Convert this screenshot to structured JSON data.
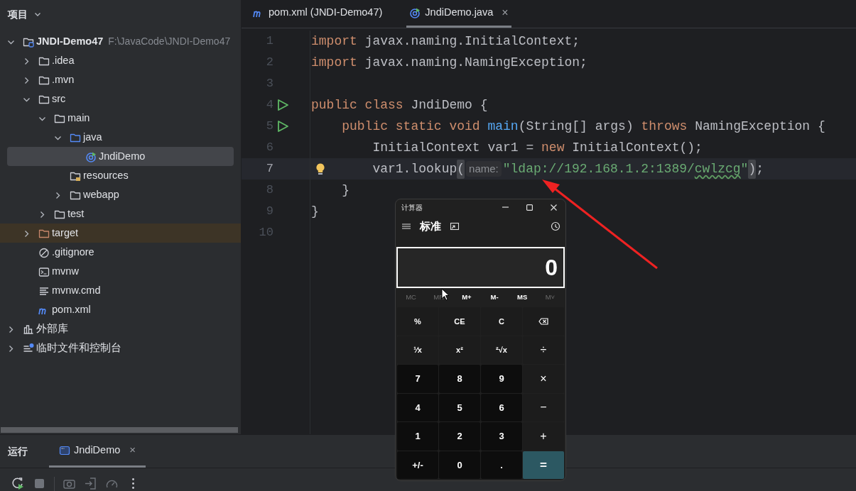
{
  "project_panel": {
    "title": "项目",
    "tree": [
      {
        "label": "JNDI-Demo47",
        "hint": "F:\\JavaCode\\JNDI-Demo47",
        "kind": "module",
        "expanded": true,
        "selected": false,
        "children": [
          {
            "label": ".idea",
            "kind": "folder",
            "expanded": false,
            "selected": false
          },
          {
            "label": ".mvn",
            "kind": "folder",
            "expanded": false,
            "selected": false
          },
          {
            "label": "src",
            "kind": "folder",
            "expanded": true,
            "selected": false,
            "children": [
              {
                "label": "main",
                "kind": "folder",
                "expanded": true,
                "selected": false,
                "children": [
                  {
                    "label": "java",
                    "kind": "source-folder",
                    "expanded": true,
                    "selected": false,
                    "children": [
                      {
                        "label": "JndiDemo",
                        "kind": "java-class",
                        "selected": true
                      }
                    ]
                  },
                  {
                    "label": "resources",
                    "kind": "resources-folder",
                    "selected": false
                  },
                  {
                    "label": "webapp",
                    "kind": "folder",
                    "expanded": false,
                    "selected": false
                  }
                ]
              },
              {
                "label": "test",
                "kind": "folder",
                "expanded": false,
                "selected": false
              }
            ]
          },
          {
            "label": "target",
            "kind": "excluded-folder",
            "expanded": false,
            "selected": false
          },
          {
            "label": ".gitignore",
            "kind": "ignore-file",
            "selected": false
          },
          {
            "label": "mvnw",
            "kind": "shell-file",
            "selected": false
          },
          {
            "label": "mvnw.cmd",
            "kind": "text-file",
            "selected": false
          },
          {
            "label": "pom.xml",
            "kind": "pom-file",
            "selected": false
          }
        ]
      },
      {
        "label": "外部库",
        "kind": "library",
        "expanded": false,
        "selected": false
      },
      {
        "label": "临时文件和控制台",
        "kind": "scratches",
        "expanded": false,
        "selected": false
      }
    ]
  },
  "editor": {
    "tabs": [
      {
        "label": "pom.xml (JNDI-Demo47)",
        "kind": "pom-file",
        "selected": false
      },
      {
        "label": "JndiDemo.java",
        "kind": "java-class",
        "selected": true,
        "close": "×"
      }
    ],
    "lines": [
      {
        "number": "1",
        "run": false,
        "bulb": false,
        "current": false,
        "tokens": [
          {
            "text": "import ",
            "kind": "kw"
          },
          {
            "text": "javax.naming.InitialContext;",
            "kind": "plain"
          }
        ]
      },
      {
        "number": "2",
        "run": false,
        "bulb": false,
        "current": false,
        "tokens": [
          {
            "text": "import ",
            "kind": "kw"
          },
          {
            "text": "javax.naming.NamingException;",
            "kind": "plain"
          }
        ]
      },
      {
        "number": "3",
        "run": false,
        "bulb": false,
        "current": false
      },
      {
        "number": "4",
        "run": true,
        "bulb": false,
        "current": false,
        "tokens": [
          {
            "text": "public class ",
            "kind": "kw"
          },
          {
            "text": "JndiDemo {",
            "kind": "plain"
          }
        ]
      },
      {
        "number": "5",
        "run": true,
        "bulb": false,
        "current": false,
        "tokens": [
          {
            "text": "    public static void ",
            "kind": "kw"
          },
          {
            "text": "main",
            "kind": "fn"
          },
          {
            "text": "(String[] args) ",
            "kind": "plain"
          },
          {
            "text": "throws ",
            "kind": "kw"
          },
          {
            "text": "NamingException {",
            "kind": "plain"
          }
        ]
      },
      {
        "number": "6",
        "run": false,
        "bulb": false,
        "current": false,
        "tokens": [
          {
            "text": "        InitialContext var1 = ",
            "kind": "plain"
          },
          {
            "text": "new ",
            "kind": "kw"
          },
          {
            "text": "InitialContext();",
            "kind": "plain"
          }
        ]
      },
      {
        "number": "7",
        "run": false,
        "bulb": true,
        "current": true,
        "tokens": [
          {
            "text": "        var1.lookup",
            "kind": "plain"
          },
          {
            "text": "(",
            "kind": "brace"
          },
          {
            "text": "name:",
            "kind": "hint"
          },
          {
            "text": "\"ldap://192.168.1.2:1389/",
            "kind": "str"
          },
          {
            "text": "cwlzcg",
            "kind": "typo"
          },
          {
            "text": "\"",
            "kind": "str"
          },
          {
            "text": ")",
            "kind": "brace"
          },
          {
            "text": ";",
            "kind": "plain"
          }
        ]
      },
      {
        "number": "8",
        "run": false,
        "bulb": false,
        "current": false,
        "tokens": [
          {
            "text": "    }",
            "kind": "plain"
          }
        ]
      },
      {
        "number": "9",
        "run": false,
        "bulb": false,
        "current": false,
        "tokens": [
          {
            "text": "}",
            "kind": "plain"
          }
        ]
      },
      {
        "number": "10",
        "run": false,
        "bulb": false,
        "current": false
      }
    ]
  },
  "calculator": {
    "title": "计算器",
    "mode": "标准",
    "display": "0",
    "memory": [
      {
        "label": "MC",
        "disabled": true
      },
      {
        "label": "MR",
        "disabled": true
      },
      {
        "label": "M+",
        "disabled": false
      },
      {
        "label": "M-",
        "disabled": false
      },
      {
        "label": "MS",
        "disabled": false
      },
      {
        "label": "M˅",
        "disabled": true
      }
    ],
    "keys": [
      {
        "label": "%",
        "kind": "function"
      },
      {
        "label": "CE",
        "kind": "function"
      },
      {
        "label": "C",
        "kind": "function"
      },
      {
        "kind": "backspace"
      },
      {
        "label": "¹⁄x",
        "kind": "function"
      },
      {
        "label": "x²",
        "kind": "function"
      },
      {
        "label": "²√x",
        "kind": "function"
      },
      {
        "label": "÷",
        "kind": "operator"
      },
      {
        "label": "7",
        "kind": "digit"
      },
      {
        "label": "8",
        "kind": "digit"
      },
      {
        "label": "9",
        "kind": "digit"
      },
      {
        "label": "×",
        "kind": "operator"
      },
      {
        "label": "4",
        "kind": "digit"
      },
      {
        "label": "5",
        "kind": "digit"
      },
      {
        "label": "6",
        "kind": "digit"
      },
      {
        "label": "−",
        "kind": "operator"
      },
      {
        "label": "1",
        "kind": "digit"
      },
      {
        "label": "2",
        "kind": "digit"
      },
      {
        "label": "3",
        "kind": "digit"
      },
      {
        "label": "+",
        "kind": "operator"
      },
      {
        "label": "+/-",
        "kind": "digit"
      },
      {
        "label": "0",
        "kind": "digit"
      },
      {
        "label": ".",
        "kind": "digit"
      },
      {
        "label": "=",
        "kind": "equals"
      }
    ]
  },
  "run_panel": {
    "title": "运行",
    "tabs": [
      {
        "label": "JndiDemo",
        "selected": true,
        "close": "×"
      }
    ]
  }
}
